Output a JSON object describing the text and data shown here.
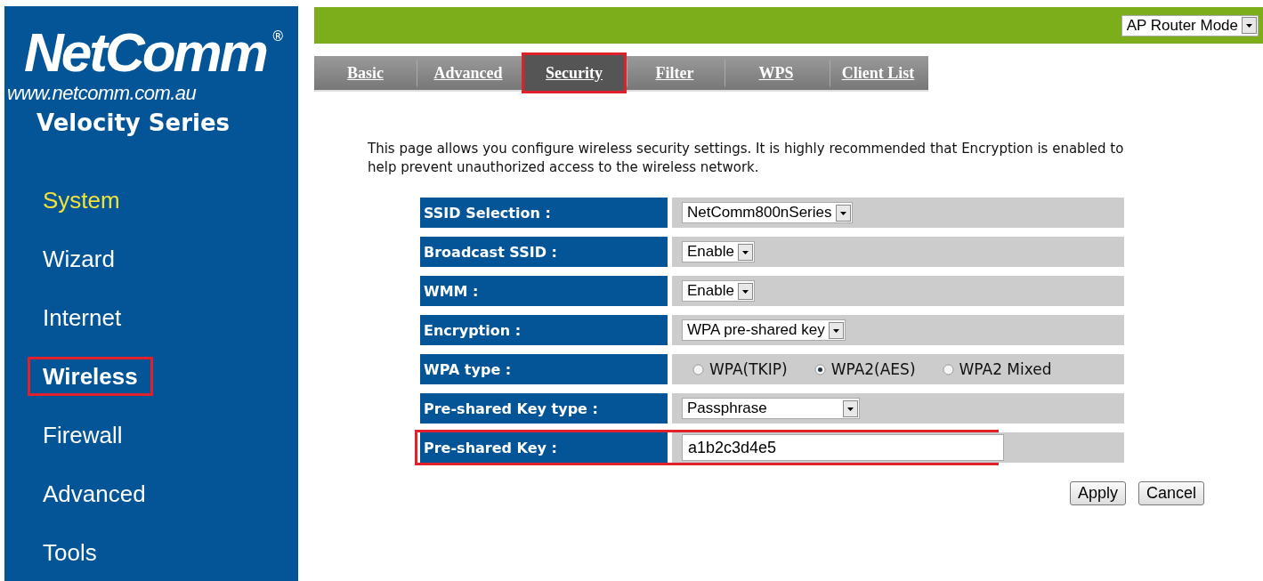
{
  "logo": {
    "brand": "NetComm",
    "registered": "®",
    "url": "www.netcomm.com.au",
    "series": "Velocity Series"
  },
  "sidebar": {
    "items": [
      {
        "label": "System",
        "selected": true,
        "highlighted": false
      },
      {
        "label": "Wizard",
        "selected": false,
        "highlighted": false
      },
      {
        "label": "Internet",
        "selected": false,
        "highlighted": false
      },
      {
        "label": "Wireless",
        "selected": false,
        "highlighted": true
      },
      {
        "label": "Firewall",
        "selected": false,
        "highlighted": false
      },
      {
        "label": "Advanced",
        "selected": false,
        "highlighted": false
      },
      {
        "label": "Tools",
        "selected": false,
        "highlighted": false
      }
    ]
  },
  "mode_select": {
    "value": "AP Router Mode"
  },
  "tabs": [
    {
      "label": "Basic",
      "selected": false
    },
    {
      "label": "Advanced",
      "selected": false
    },
    {
      "label": "Security",
      "selected": true
    },
    {
      "label": "Filter",
      "selected": false
    },
    {
      "label": "WPS",
      "selected": false
    },
    {
      "label": "Client List",
      "selected": false
    }
  ],
  "description": "This page allows you configure wireless security settings. It is highly recommended that Encryption is enabled to help prevent unauthorized access to the wireless network.",
  "settings": [
    {
      "label": "SSID Selection :",
      "kind": "select",
      "value": "NetComm800nSeries",
      "highlighted": false
    },
    {
      "label": "Broadcast SSID :",
      "kind": "select",
      "value": "Enable",
      "highlighted": false
    },
    {
      "label": "WMM :",
      "kind": "select",
      "value": "Enable",
      "highlighted": false
    },
    {
      "label": "Encryption :",
      "kind": "select",
      "value": "WPA pre-shared key",
      "highlighted": false
    },
    {
      "label": "WPA type :",
      "kind": "radio",
      "options": [
        {
          "label": "WPA(TKIP)",
          "selected": false
        },
        {
          "label": "WPA2(AES)",
          "selected": true
        },
        {
          "label": "WPA2 Mixed",
          "selected": false
        }
      ],
      "highlighted": false
    },
    {
      "label": "Pre-shared Key type :",
      "kind": "select",
      "value": "Passphrase",
      "highlighted": false
    },
    {
      "label": "Pre-shared Key :",
      "kind": "text",
      "value": "a1b2c3d4e5",
      "highlighted": true
    }
  ],
  "buttons": [
    "Apply",
    "Cancel"
  ]
}
